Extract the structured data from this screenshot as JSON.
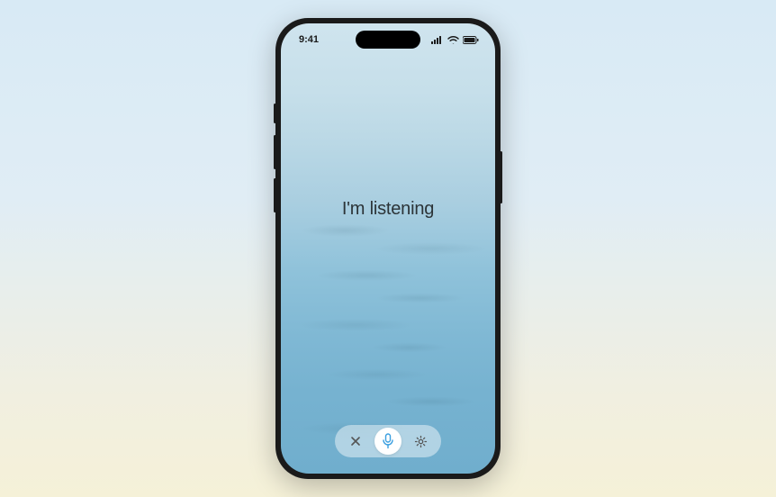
{
  "status_bar": {
    "time": "9:41"
  },
  "main": {
    "prompt_text": "I'm listening"
  },
  "toolbar": {
    "close_icon": "close-icon",
    "mic_icon": "microphone-icon",
    "settings_icon": "gear-icon"
  },
  "colors": {
    "accent": "#3a9fe0",
    "text": "#2c3438"
  }
}
